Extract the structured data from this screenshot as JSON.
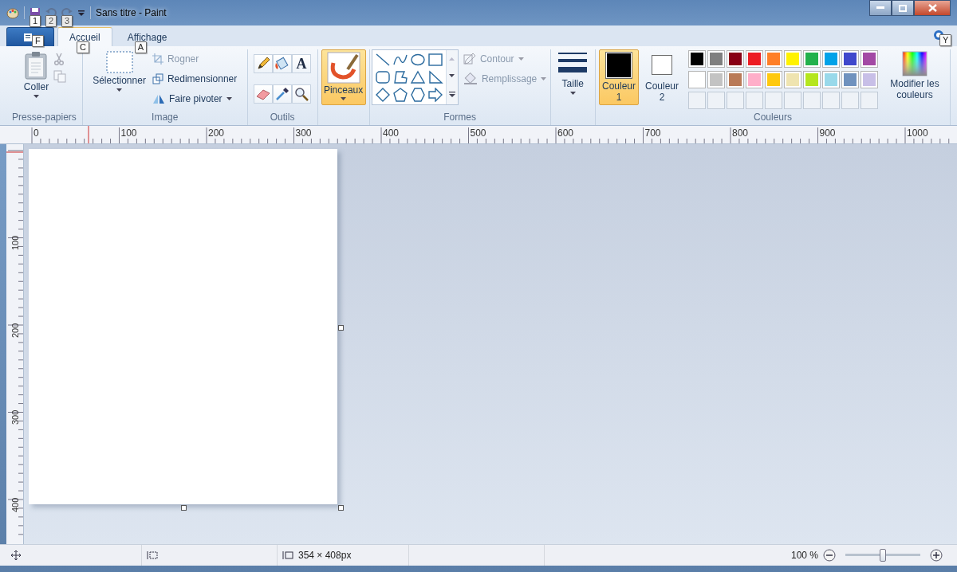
{
  "window": {
    "title": "Sans titre - Paint"
  },
  "quick_access": [
    {
      "kind": "save",
      "keytip": "1",
      "disabled": false
    },
    {
      "kind": "undo",
      "keytip": "2",
      "disabled": true
    },
    {
      "kind": "redo",
      "keytip": "3",
      "disabled": true
    }
  ],
  "file_menu": {
    "keytip": "F"
  },
  "tabs": [
    {
      "label": "Accueil",
      "selected": true,
      "keytip": "C"
    },
    {
      "label": "Affichage",
      "selected": false,
      "keytip": "A"
    }
  ],
  "help": {
    "keytip": "Y"
  },
  "clipboard": {
    "paste": "Coller",
    "cut_disabled": true,
    "copy_disabled": true,
    "group": "Presse-papiers"
  },
  "image": {
    "select": "Sélectionner",
    "items": [
      {
        "kind": "crop",
        "label": "Rogner",
        "disabled": true,
        "dropdown": false
      },
      {
        "kind": "resize",
        "label": "Redimensionner",
        "disabled": false,
        "dropdown": false
      },
      {
        "kind": "rotate",
        "label": "Faire pivoter",
        "disabled": false,
        "dropdown": true
      }
    ],
    "group": "Image"
  },
  "tools": {
    "items": [
      {
        "kind": "pencil"
      },
      {
        "kind": "fill"
      },
      {
        "kind": "text",
        "glyph": "A"
      },
      {
        "kind": "eraser"
      },
      {
        "kind": "picker"
      },
      {
        "kind": "magnifier"
      }
    ],
    "group": "Outils"
  },
  "brushes": {
    "label": "Pinceaux",
    "selected": true
  },
  "shapes": {
    "outline": {
      "label": "Contour",
      "disabled": true
    },
    "fill": {
      "label": "Remplissage",
      "disabled": true
    },
    "group": "Formes"
  },
  "size": {
    "label": "Taille"
  },
  "colors": {
    "color1": {
      "label": "Couleur",
      "number": "1",
      "color": "#000000",
      "selected": true
    },
    "color2": {
      "label": "Couleur",
      "number": "2",
      "color": "#ffffff",
      "selected": false
    },
    "palette": [
      {
        "color": "#000000"
      },
      {
        "color": "#7f7f7f"
      },
      {
        "color": "#880015"
      },
      {
        "color": "#ed1c24"
      },
      {
        "color": "#ff7f27"
      },
      {
        "color": "#fff200"
      },
      {
        "color": "#22b14c"
      },
      {
        "color": "#00a2e8"
      },
      {
        "color": "#3f48cc"
      },
      {
        "color": "#a349a4"
      },
      {
        "color": "#ffffff"
      },
      {
        "color": "#c3c3c3"
      },
      {
        "color": "#b97a57"
      },
      {
        "color": "#ffaec9"
      },
      {
        "color": "#ffc90e"
      },
      {
        "color": "#efe4b0"
      },
      {
        "color": "#b5e61d"
      },
      {
        "color": "#99d9ea"
      },
      {
        "color": "#7092be"
      },
      {
        "color": "#c8bfe7"
      }
    ],
    "edit": "Modifier les couleurs",
    "group": "Couleurs"
  },
  "ruler": {
    "horizontal": [
      "0",
      "100",
      "200",
      "300",
      "400",
      "500",
      "600",
      "700",
      "800",
      "900",
      "1000"
    ],
    "vertical": [
      "100",
      "200",
      "300",
      "400"
    ]
  },
  "status_bar": {
    "image_size": "354 × 408px",
    "zoom": "100 %",
    "zoom_slider": {
      "level": 0.5
    }
  }
}
